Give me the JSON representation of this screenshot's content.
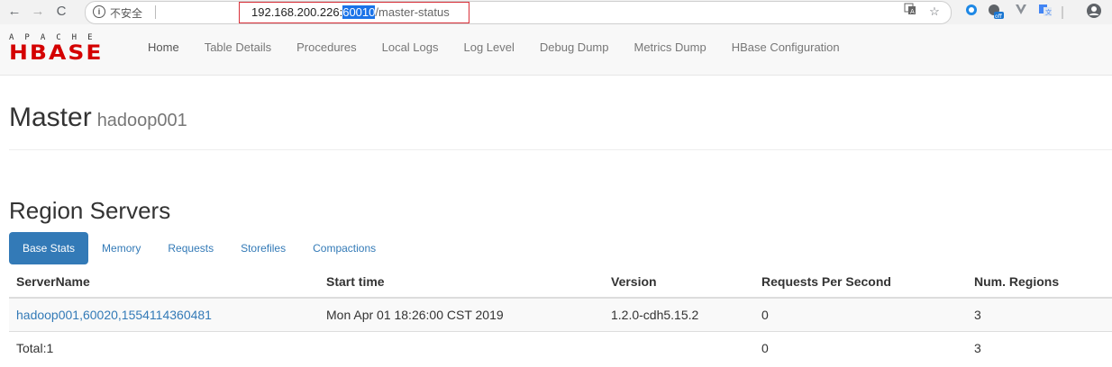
{
  "browser": {
    "insecure_label": "不安全",
    "url_host": "192.168.200.226:",
    "url_port": "60010",
    "url_path": "/master-status",
    "icons": [
      "back-arrow-icon",
      "forward-arrow-icon",
      "reload-icon",
      "info-icon",
      "translate-icon",
      "star-icon",
      "extension-icon",
      "google-off-icon",
      "vue-extension-icon",
      "google-translate-icon",
      "profile-icon"
    ]
  },
  "navbar": {
    "logo_top": "APACHE",
    "logo_main": "HBASE",
    "links": [
      "Home",
      "Table Details",
      "Procedures",
      "Local Logs",
      "Log Level",
      "Debug Dump",
      "Metrics Dump",
      "HBase Configuration"
    ]
  },
  "page": {
    "title": "Master",
    "subtitle": "hadoop001"
  },
  "region_servers": {
    "heading": "Region Servers",
    "tabs": [
      "Base Stats",
      "Memory",
      "Requests",
      "Storefiles",
      "Compactions"
    ],
    "active_tab": "Base Stats",
    "columns": [
      "ServerName",
      "Start time",
      "Version",
      "Requests Per Second",
      "Num. Regions"
    ],
    "rows": [
      {
        "server": "hadoop001,60020,1554114360481",
        "start": "Mon Apr 01 18:26:00 CST 2019",
        "version": "1.2.0-cdh5.15.2",
        "rps": "0",
        "regions": "3"
      }
    ],
    "total": {
      "label": "Total:1",
      "rps": "0",
      "regions": "3"
    }
  },
  "colors": {
    "accent": "#337ab7",
    "logo_red": "#d40000",
    "url_highlight": "#1a73e8",
    "url_box": "#d9313a"
  }
}
